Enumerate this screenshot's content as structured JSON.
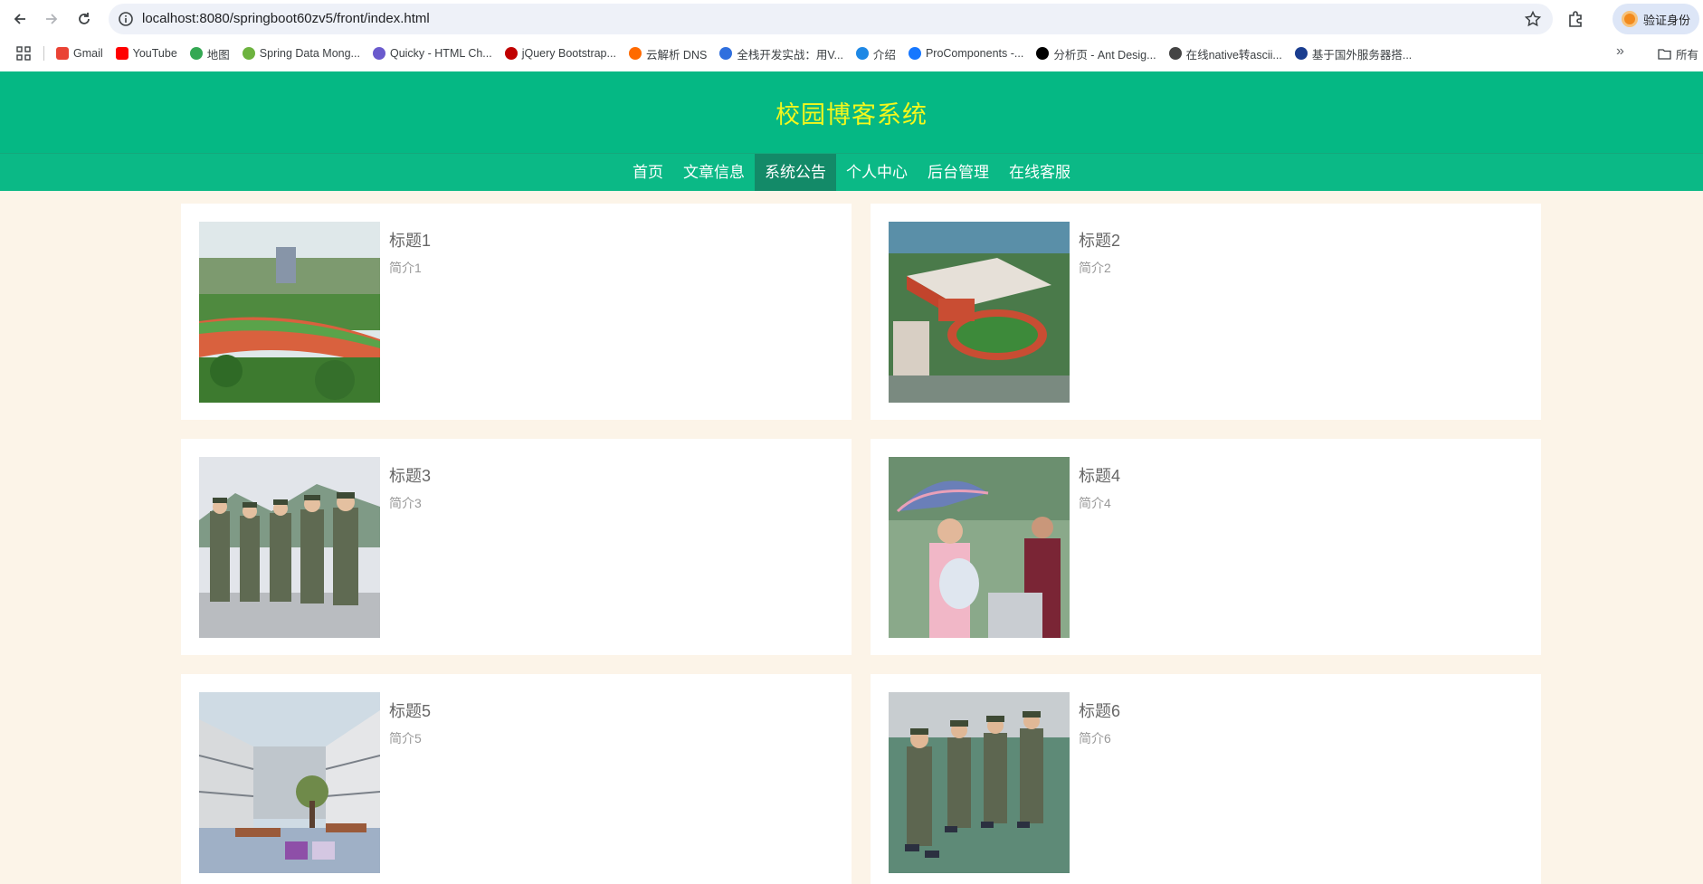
{
  "browser": {
    "url": "localhost:8080/springboot60zv5/front/index.html",
    "profile_label": "验证身份",
    "bookmarks": [
      {
        "label": "Gmail",
        "icon": "gmail-icon",
        "color": "#ea4335"
      },
      {
        "label": "YouTube",
        "icon": "youtube-icon",
        "color": "#ff0000"
      },
      {
        "label": "地图",
        "icon": "maps-icon",
        "color": "#34a853"
      },
      {
        "label": "Spring Data Mong...",
        "icon": "spring-icon",
        "color": "#6db33f"
      },
      {
        "label": "Quicky - HTML Ch...",
        "icon": "quicky-icon",
        "color": "#6a5acd"
      },
      {
        "label": "jQuery Bootstrap...",
        "icon": "jquery-icon",
        "color": "#c00000"
      },
      {
        "label": "云解析 DNS",
        "icon": "cloud-dns-icon",
        "color": "#ff6a00"
      },
      {
        "label": "全栈开发实战：用V...",
        "icon": "m-icon",
        "color": "#2f6fde"
      },
      {
        "label": "介绍",
        "icon": "globe-icon",
        "color": "#1e88e5"
      },
      {
        "label": "ProComponents -...",
        "icon": "procomponents-icon",
        "color": "#1677ff"
      },
      {
        "label": "分析页 - Ant Desig...",
        "icon": "pro-icon",
        "color": "#000000"
      },
      {
        "label": "在线native转ascii...",
        "icon": "web-icon",
        "color": "#444444"
      },
      {
        "label": "基于国外服务器搭...",
        "icon": "flag-icon",
        "color": "#1a3d8f"
      }
    ],
    "bookmarks_more": "»",
    "bookmarks_folder": "所有"
  },
  "site": {
    "title": "校园博客系统",
    "title_color": "#f4f71c",
    "header_color": "#05b884",
    "nav": [
      "首页",
      "文章信息",
      "系统公告",
      "个人中心",
      "后台管理",
      "在线客服"
    ],
    "nav_active_index": 2
  },
  "notices": [
    {
      "title": "标题1",
      "desc": "简介1",
      "image": "campus-sports-field"
    },
    {
      "title": "标题2",
      "desc": "简介2",
      "image": "school-aerial-view"
    },
    {
      "title": "标题3",
      "desc": "简介3",
      "image": "students-military-training"
    },
    {
      "title": "标题4",
      "desc": "简介4",
      "image": "student-with-umbrella"
    },
    {
      "title": "标题5",
      "desc": "简介5",
      "image": "modern-school-courtyard"
    },
    {
      "title": "标题6",
      "desc": "简介6",
      "image": "students-marching"
    }
  ]
}
